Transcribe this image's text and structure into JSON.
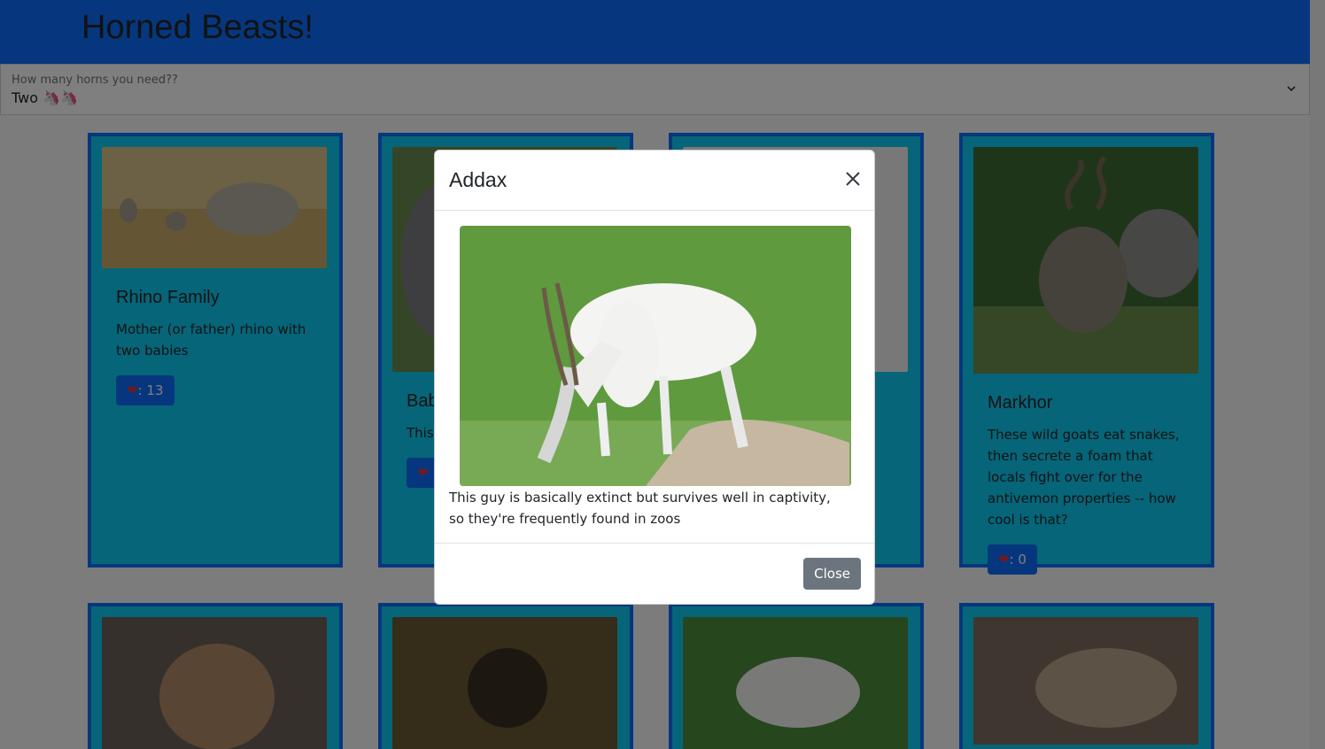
{
  "header": {
    "title": "Horned Beasts!"
  },
  "filter": {
    "label": "How many horns you need??",
    "value": "Two 🦄🦄"
  },
  "cards": [
    {
      "title": "Rhino Family",
      "description": "Mother (or father) rhino with two babies",
      "likes": ": 13"
    },
    {
      "title": "Bab",
      "description": "This look",
      "likes": ""
    },
    {
      "title": "",
      "description": "",
      "likes": ""
    },
    {
      "title": "Markhor",
      "description": "These wild goats eat snakes, then secrete a foam that locals fight over for the antivemon properties -- how cool is that?",
      "likes": ": 0"
    }
  ],
  "modal": {
    "title": "Addax",
    "description": "This guy is basically extinct but survives well in captivity, so they're frequently found in zoos",
    "close_label": "Close"
  },
  "icons": {
    "heart": "heart-icon",
    "close": "close-icon",
    "chevron": "chevron-down-icon"
  }
}
